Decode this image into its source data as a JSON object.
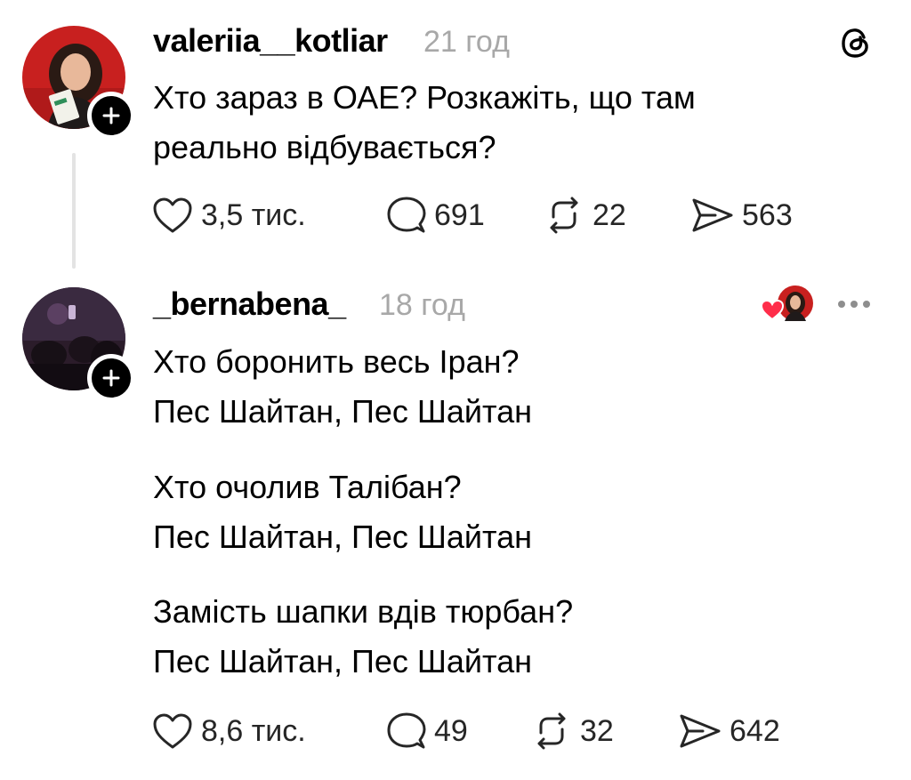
{
  "posts": [
    {
      "username": "valeriia__kotliar",
      "time": "21 год",
      "lines": [
        "Хто зараз в ОАЕ? Розкажіть, що там",
        "реально відбувається?"
      ],
      "actions": {
        "likes": "3,5 тис.",
        "comments": "691",
        "reposts": "22",
        "shares": "563"
      }
    },
    {
      "username": "_bernabena_",
      "time": "18 год",
      "lines": [
        "Хто боронить весь Іран?",
        "Пес Шайтан, Пес Шайтан",
        "Хто очолив Талібан?",
        "Пес Шайтан, Пес Шайтан",
        "Замість шапки вдів тюрбан?",
        "Пес Шайтан, Пес Шайтан"
      ],
      "actions": {
        "likes": "8,6 тис.",
        "comments": "49",
        "reposts": "32",
        "shares": "642"
      }
    }
  ],
  "icons": {
    "app_logo": "threads-logo-icon",
    "follow": "plus-icon",
    "like": "heart-icon",
    "comment": "comment-bubble-icon",
    "repost": "repost-icon",
    "share": "share-send-icon",
    "more": "more-dots-icon",
    "liked_by_author": "liked-by-author-avatar-icon"
  },
  "colors": {
    "text": "#000000",
    "muted": "#a8a8a8",
    "like_heart": "#ff2d4a"
  }
}
